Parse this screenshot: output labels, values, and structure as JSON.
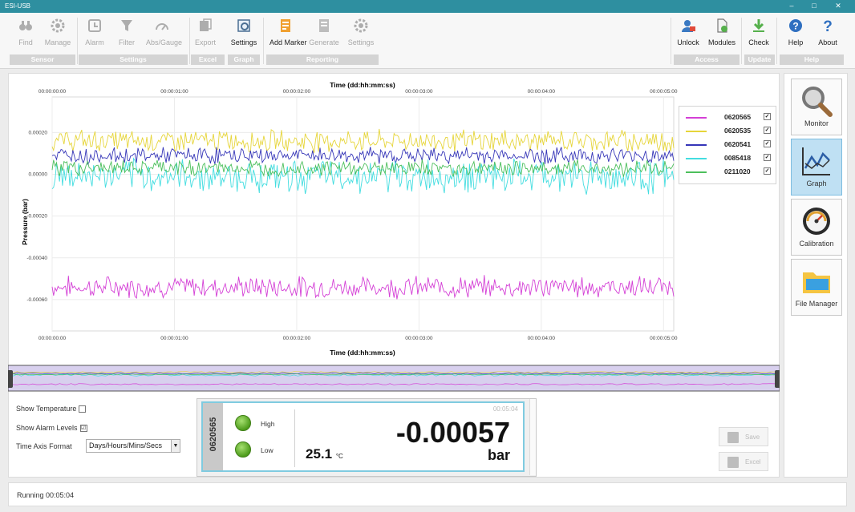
{
  "window": {
    "title": "ESI-USB",
    "minimize": "–",
    "maximize": "□",
    "close": "✕"
  },
  "ribbon": {
    "buttons": [
      {
        "label": "Find",
        "icon": "binoculars-icon",
        "enabled": false
      },
      {
        "label": "Manage",
        "icon": "gear-icon",
        "enabled": false
      },
      {
        "label": "Alarm",
        "icon": "alarm-clock-icon",
        "enabled": false
      },
      {
        "label": "Filter",
        "icon": "funnel-icon",
        "enabled": false
      },
      {
        "label": "Abs/Gauge",
        "icon": "gauge-toggle-icon",
        "enabled": false
      },
      {
        "label": "Export",
        "icon": "export-icon",
        "enabled": false
      },
      {
        "label": "Settings",
        "icon": "graph-settings-icon",
        "enabled": true
      },
      {
        "label": "Add Marker",
        "icon": "add-marker-icon",
        "enabled": true
      },
      {
        "label": "Generate",
        "icon": "generate-report-icon",
        "enabled": false
      },
      {
        "label": "Settings",
        "icon": "report-settings-icon",
        "enabled": false
      },
      {
        "label": "Unlock",
        "icon": "unlock-user-icon",
        "enabled": true
      },
      {
        "label": "Modules",
        "icon": "modules-icon",
        "enabled": true
      },
      {
        "label": "Check",
        "icon": "check-update-icon",
        "enabled": true
      },
      {
        "label": "Help",
        "icon": "help-icon",
        "enabled": true
      },
      {
        "label": "About",
        "icon": "about-icon",
        "enabled": true
      }
    ],
    "groups": [
      "Sensor",
      "Settings",
      "Excel",
      "Graph",
      "Reporting",
      "Access",
      "Update",
      "Help"
    ]
  },
  "sidebar": {
    "items": [
      {
        "label": "Monitor",
        "icon": "magnifier-icon",
        "active": false
      },
      {
        "label": "Graph",
        "icon": "line-graph-icon",
        "active": true
      },
      {
        "label": "Calibration",
        "icon": "gauge-icon",
        "active": false
      },
      {
        "label": "File Manager",
        "icon": "folder-icon",
        "active": false
      }
    ]
  },
  "chart_data": {
    "type": "line",
    "title": "Time (dd:hh:mm:ss)",
    "xlabel": "Time (dd:hh:mm:ss)",
    "ylabel": "Pressure (bar)",
    "xlim": [
      0,
      305
    ],
    "ylim": [
      -0.00075,
      0.00037
    ],
    "x_ticks": [
      0,
      60,
      120,
      180,
      240,
      300
    ],
    "x_tick_labels": [
      "00:00:00:00",
      "00:00:01:00",
      "00:00:02:00",
      "00:00:03:00",
      "00:00:04:00",
      "00:00:05:00"
    ],
    "y_ticks": [
      0.0002,
      0.0,
      -0.0002,
      -0.0004,
      -0.0006
    ],
    "y_tick_labels": [
      "0.00020",
      "0.00000",
      "-0.00020",
      "-0.00040",
      "-0.00060"
    ],
    "grid": true,
    "legend_position": "top-right",
    "series": [
      {
        "name": "0620565",
        "color": "#d43fd6",
        "mean": -0.00054,
        "noise": 4e-05,
        "checked": true
      },
      {
        "name": "0620535",
        "color": "#e6d53a",
        "mean": 0.00016,
        "noise": 4e-05,
        "checked": true
      },
      {
        "name": "0620541",
        "color": "#3636b8",
        "mean": 9e-05,
        "noise": 3e-05,
        "checked": true
      },
      {
        "name": "0085418",
        "color": "#43dde0",
        "mean": -1e-05,
        "noise": 6e-05,
        "checked": true
      },
      {
        "name": "0211020",
        "color": "#4cbf5c",
        "mean": 3e-05,
        "noise": 3e-05,
        "checked": true
      }
    ]
  },
  "options": {
    "show_temperature_label": "Show Temperature",
    "show_temperature": false,
    "show_alarm_label": "Show Alarm Levels",
    "show_alarm": true,
    "time_axis_label": "Time Axis Format",
    "time_axis_value": "Days/Hours/Mins/Secs",
    "check_mark": "☑"
  },
  "readout": {
    "sensor": "0620565",
    "high_label": "High",
    "low_label": "Low",
    "value": "-0.00057",
    "unit": "bar",
    "temperature": "25.1",
    "temperature_unit": "°C",
    "elapsed": "00:05:04"
  },
  "actions": {
    "save": "Save",
    "excel": "Excel"
  },
  "status": {
    "text": "Running 00:05:04"
  }
}
